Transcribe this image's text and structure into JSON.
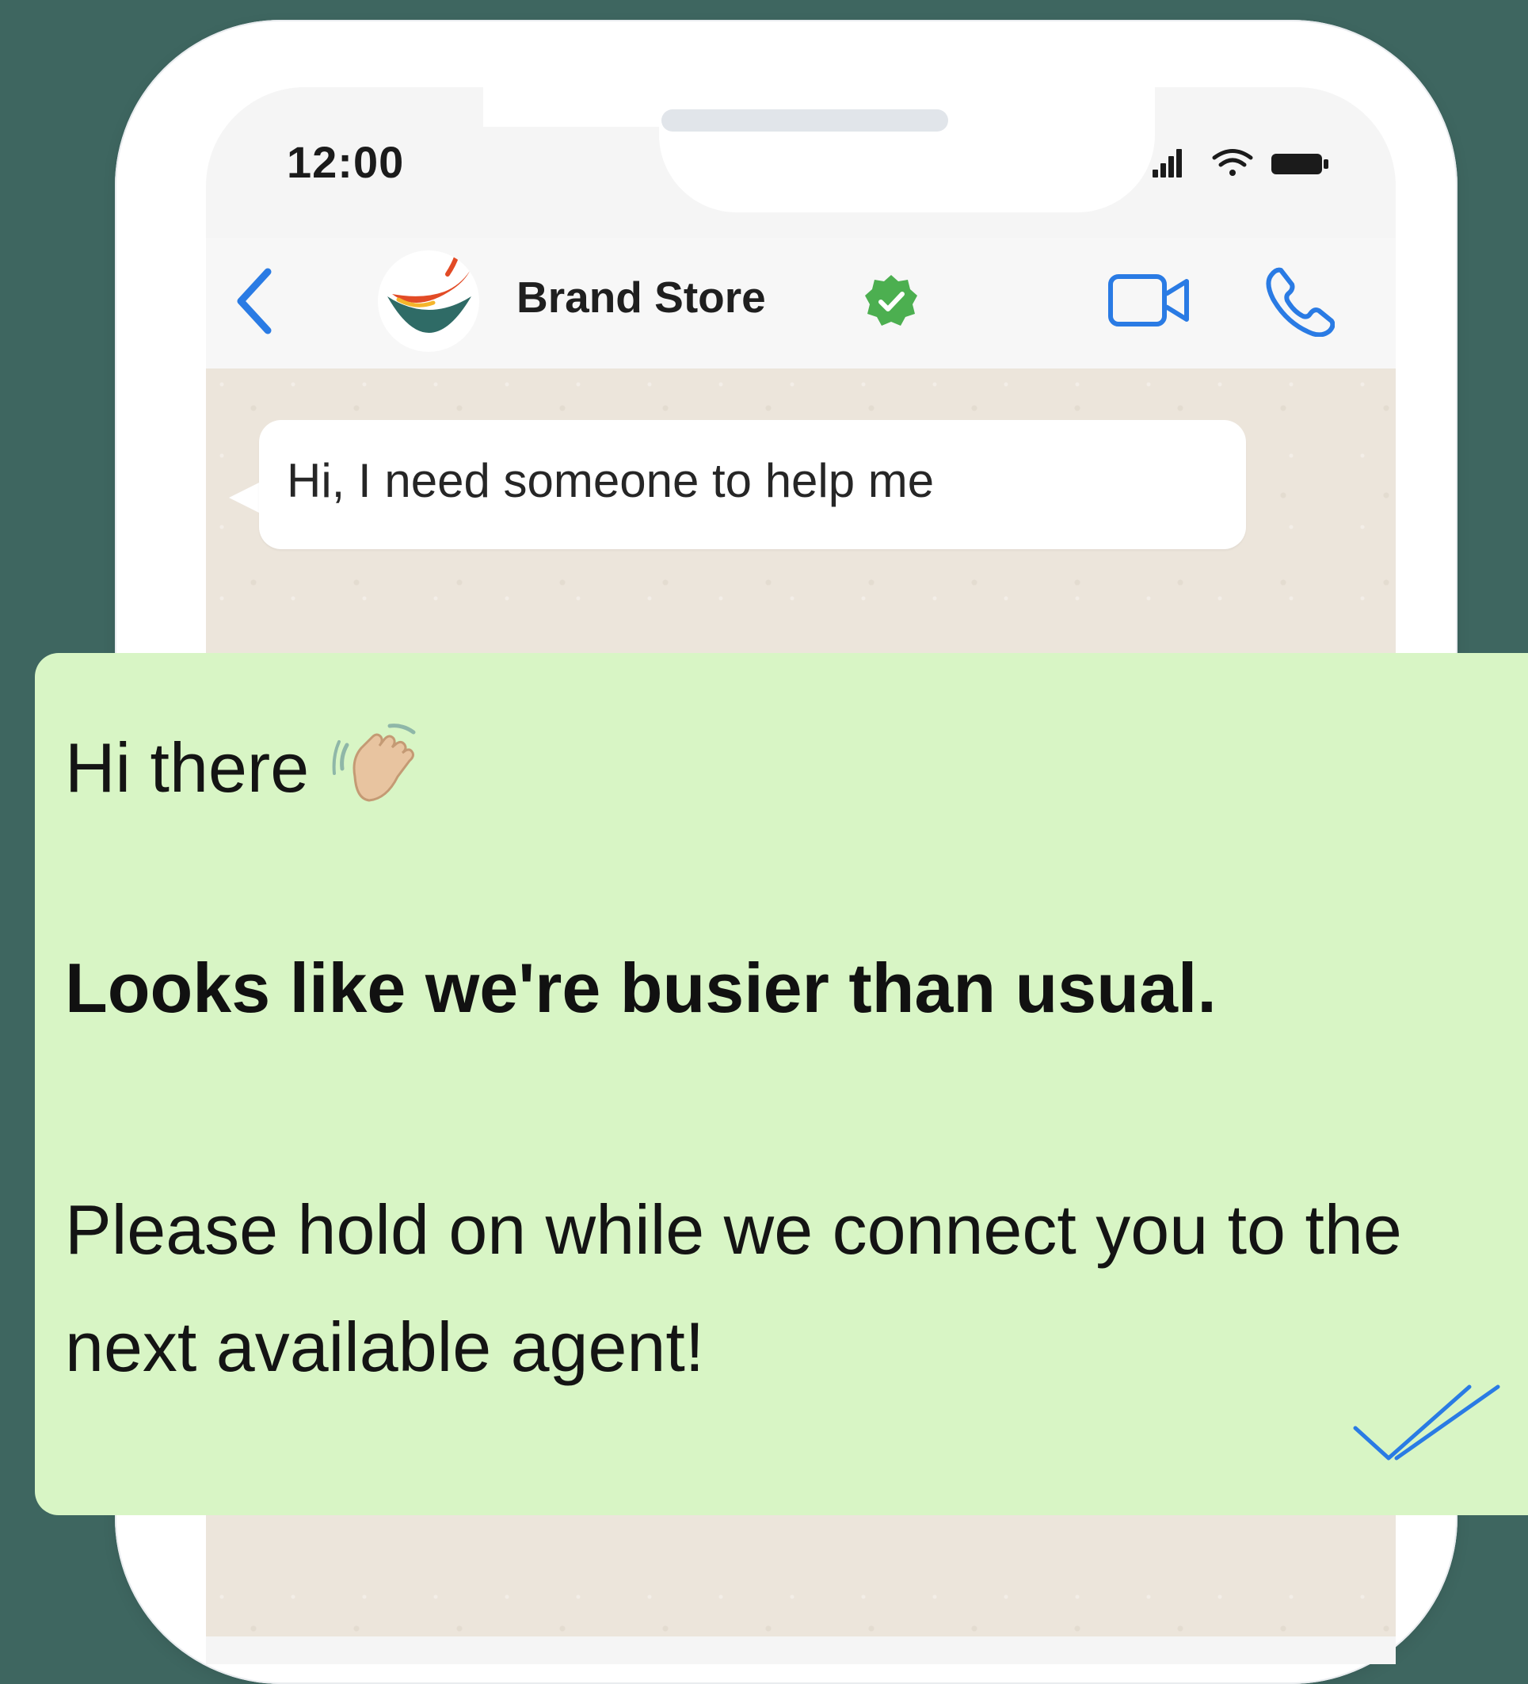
{
  "status_bar": {
    "time": "12:00"
  },
  "chat_header": {
    "contact_name": "Brand Store",
    "verified": true,
    "icons": [
      "back-chevron-icon",
      "verified-badge-icon",
      "video-call-icon",
      "phone-call-icon"
    ]
  },
  "messages": {
    "incoming": {
      "text": "Hi, I need someone to help me"
    },
    "reply": {
      "greeting": "Hi there",
      "greeting_emoji": "waving-hand-icon",
      "busy_notice": "Looks like we're busier than usual.",
      "hold_notice": "Please hold on while we connect you to the next available agent!",
      "status": "read-double-check-icon"
    }
  },
  "colors": {
    "background": "#3e6660",
    "accent_blue": "#2a7be4",
    "verified_green": "#4caf50",
    "reply_bubble": "#d8f5c5",
    "chat_wallpaper": "#ece5db"
  }
}
